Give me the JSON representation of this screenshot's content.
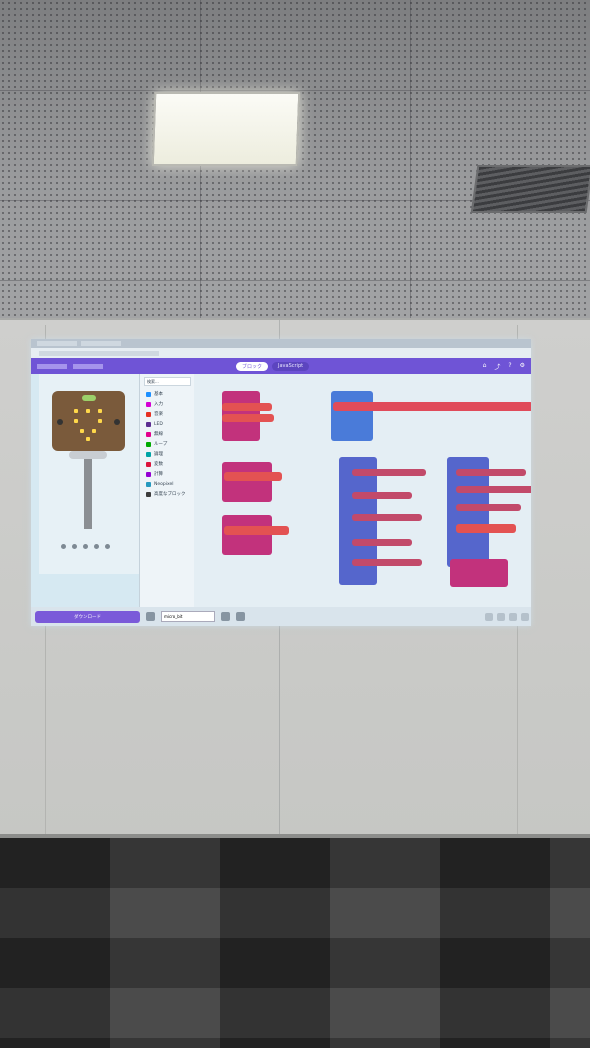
{
  "scene": {
    "colors": {
      "ceiling": "#8e8f91",
      "wall": "#cfcfcd",
      "carpet": "#3a3a3a",
      "screen_accent": "#6f54d6"
    },
    "icons": [
      "ceiling-light-icon",
      "air-vent-icon",
      "microbit-board-icon",
      "home-icon",
      "share-icon",
      "help-icon",
      "settings-icon"
    ]
  },
  "editor": {
    "tabs": {
      "blocks": "ブロック",
      "javascript": "JavaScript"
    },
    "toolbox": {
      "search_placeholder": "検索...",
      "categories": [
        {
          "label": "基本",
          "color": "#1e90ff"
        },
        {
          "label": "入力",
          "color": "#d400d4"
        },
        {
          "label": "音楽",
          "color": "#e63022"
        },
        {
          "label": "LED",
          "color": "#5c2d91"
        },
        {
          "label": "無線",
          "color": "#e3008c"
        },
        {
          "label": "ループ",
          "color": "#00aa00"
        },
        {
          "label": "論理",
          "color": "#00a4a6"
        },
        {
          "label": "変数",
          "color": "#dc143c"
        },
        {
          "label": "計算",
          "color": "#9400d3"
        },
        {
          "label": "Neopixel",
          "color": "#2699bf"
        },
        {
          "label": "高度なブロック",
          "color": "#3c3c3c"
        }
      ]
    },
    "bottom": {
      "download_label": "ダウンロード",
      "project_name": "micro_bit"
    }
  }
}
